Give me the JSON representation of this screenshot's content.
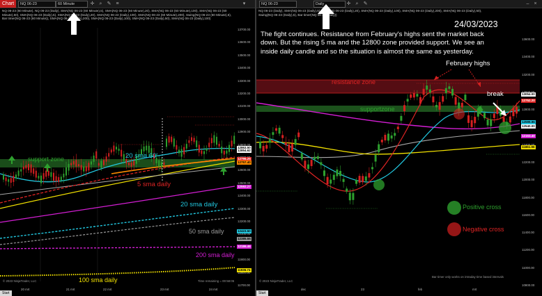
{
  "colors": {
    "bull": "#2ea02e",
    "bear": "#d42020",
    "titlebar_accent": "#c41e1e",
    "support_zone": "#1f5a1f",
    "resistance_zone": "#5a0e14"
  },
  "left": {
    "title": "Chart",
    "instrument": "NQ 06-23",
    "timeframe": "60 Minute",
    "indicators_text": "NQ 06-23 (60 Minute), NQ 06-23 (Daily), SMA(NQ 06-23 (60 Minute),5), SMA(NQ 06-23 (60 Minute),20), SMA(NQ 06-23 (60 Minute),100), SMA(NQ 06-23 (60 Minute),50), SMA(NQ 06-23 (Daily),5), SMA(NQ 06-23 (Daily),20), SMA(NQ 06-23 (Daily),100), SMA(NQ 06-23 (60 Minute),200), Swing(NQ 06-23 (60 Minute),5), Bar timer(NQ 06-23 (60 Minute)), SMA(NQ 06-23 (Daily),200), SMA(NQ 06-23 (Daily),100), SMA(NQ 06-23 (Daily),50), SMA(NQ 06-23 (Daily),100)",
    "labels": {
      "support_zone": "support zone",
      "sma20_60": "20 sma 60'",
      "sma5_daily": "5 sma daily",
      "sma20_daily": "20 sma daily",
      "sma50_daily": "50 sma daily",
      "sma200_daily": "200 sma daily",
      "sma100_daily": "100 sma daily"
    },
    "price_axis": [
      "13700.00",
      "13600.00",
      "13500.00",
      "13400.00",
      "13300.00",
      "13200.00",
      "13100.00",
      "13000.00",
      "12900.00",
      "12800.00",
      "12700.00",
      "12600.00",
      "12500.00",
      "12400.00",
      "12300.00",
      "12200.00",
      "12100.00",
      "12000.00",
      "11900.00",
      "11800.00",
      "11700.00"
    ],
    "price_boxes": [
      "12863.50",
      "12854.62",
      "12796.25",
      "12757.40",
      "12592.27",
      "12423.50",
      "12385.55",
      "12186.46",
      "11936.74"
    ],
    "dates": [
      "20 mrt",
      "21 mrt",
      "22 mrt",
      "23 mrt",
      "24 mrt"
    ],
    "copyright": "© 2023 NinjaTrader, LLC",
    "bar_timer": "Time remaining = 00:58:05"
  },
  "right": {
    "instrument": "NQ 06-23",
    "timeframe": "Daily",
    "indicators_text": "NQ 06-23 (Daily), SMA(NQ 06-23 (Daily),5), SMA(NQ 06-23 (Daily),20), SMA(NQ 06-23 (Daily),100), SMA(NQ 06-23 (Daily),200), SMA(NQ 06-23 (Daily),50), Swing(NQ 06-23 (Daily),5), Bar timer(NQ 06-23 (Daily))",
    "date_title": "24/03/2023",
    "commentary": "The fight continues. Resistance from February's highs sent the market back down. But the rising 5 ma and the 12800 zone provided support. We see an inside daily candle and so the situation is almost the same as yesterday.",
    "labels": {
      "february_highs": "February highs",
      "resistance_zone": "resistance zone",
      "supportzone": "supportzone",
      "break": "break",
      "positive_cross": "Positive cross",
      "negative_cross": "Negative cross"
    },
    "price_axis": [
      "13600.00",
      "13400.00",
      "13200.00",
      "13000.00",
      "12800.00",
      "12600.00",
      "12400.00",
      "12200.00",
      "12000.00",
      "11800.00",
      "11600.00",
      "11400.00",
      "11200.00",
      "11000.00",
      "10800.00"
    ],
    "price_boxes": [
      "13054.00",
      "12752.20",
      "12599.96",
      "12540.00",
      "12163.40",
      "11861.96"
    ],
    "dates": [
      "dec",
      "23",
      "feb",
      "mrt"
    ],
    "copyright": "© 2023 NinjaTrader, LLC",
    "bar_timer": "Bar timer only works on intraday time based intervals"
  },
  "tabs": {
    "left": "Start",
    "right": "Start"
  }
}
